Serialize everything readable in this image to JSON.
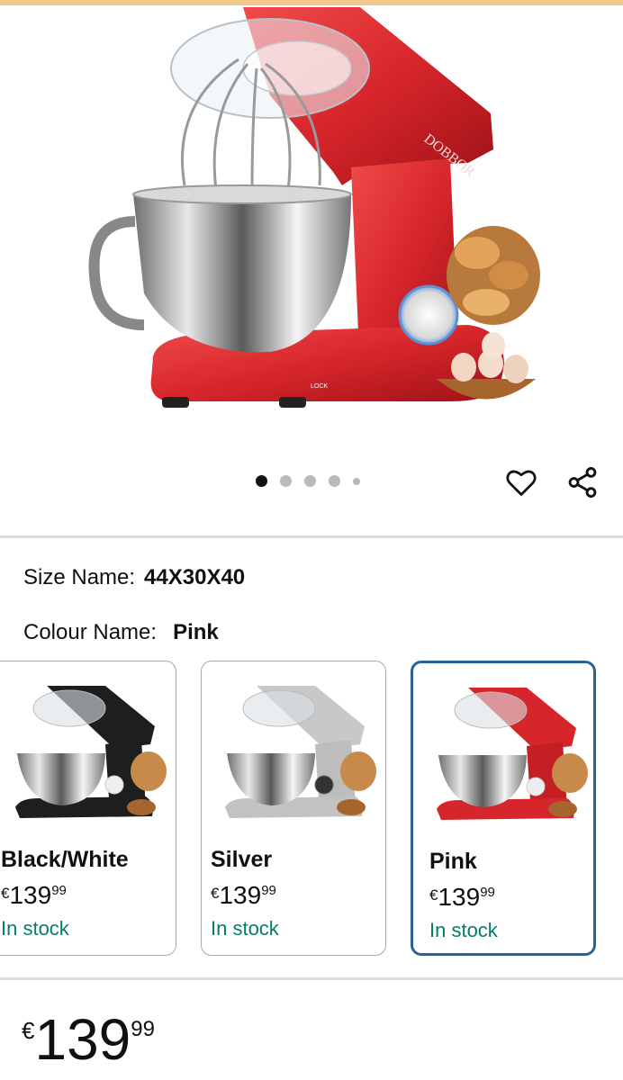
{
  "hero": {
    "brand_text": "DOBBOR",
    "lock_text": "LOCK",
    "image_count": 5,
    "active_index": 0
  },
  "actions": {
    "favorite_icon": "heart-icon",
    "share_icon": "share-icon"
  },
  "size": {
    "label": "Size Name:",
    "value": "44X30X40"
  },
  "colour": {
    "label": "Colour Name:",
    "value": "Pink"
  },
  "variants": [
    {
      "name": "Black/White",
      "currency": "€",
      "whole": "139",
      "fraction": "99",
      "stock": "In stock",
      "body_color": "#1e1e1e",
      "selected": false
    },
    {
      "name": "Silver",
      "currency": "€",
      "whole": "139",
      "fraction": "99",
      "stock": "In stock",
      "body_color": "#c8c8c8",
      "selected": false
    },
    {
      "name": "Pink",
      "currency": "€",
      "whole": "139",
      "fraction": "99",
      "stock": "In stock",
      "body_color": "#d7262b",
      "selected": true
    }
  ],
  "price": {
    "currency": "€",
    "whole": "139",
    "fraction": "99"
  },
  "colors": {
    "accent_selected": "#2a6496",
    "in_stock": "#067d62",
    "mixer_red": "#d7262b"
  }
}
